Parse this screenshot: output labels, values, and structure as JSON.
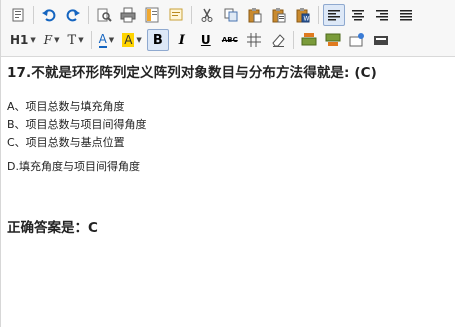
{
  "toolbar": {
    "heading_label": "H1",
    "font_family_label": "F",
    "font_size_label": "T",
    "font_color_label": "A",
    "bg_color_label": "A",
    "bold_label": "B",
    "italic_label": "I",
    "underline_label": "U",
    "strike_label": "ABC",
    "accent_color": "#1565c0",
    "highlight_color": "#ffd400"
  },
  "content": {
    "question": "17.不就是环形阵列定义阵列对象数目与分布方法得就是: (C)",
    "options": [
      "A、项目总数与填充角度",
      "B、项目总数与项目间得角度",
      "C、项目总数与基点位置",
      "D.填充角度与项目间得角度"
    ],
    "answer": "正确答案是：C"
  }
}
